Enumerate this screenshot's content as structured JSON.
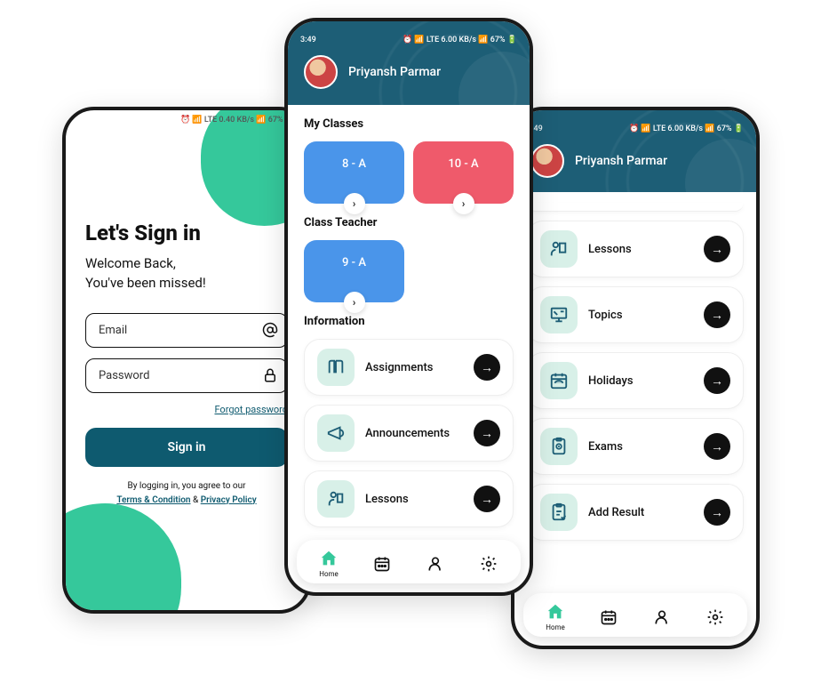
{
  "status": {
    "time": "3:49",
    "indicators": "⏰ 📶 LTE 6.00 KB/s 📶 67% 🔋"
  },
  "statusAlt": {
    "indicators": "⏰ 📶 LTE 0.40 KB/s 📶 67% 🔋"
  },
  "signin": {
    "title": "Let's Sign in",
    "welcome_line1": "Welcome Back,",
    "welcome_line2": "You've been missed!",
    "email_placeholder": "Email",
    "password_placeholder": "Password",
    "forgot": "Forgot password",
    "button": "Sign in",
    "agree_prefix": "By logging in, you agree to our",
    "terms": "Terms & Condition",
    "amp": " & ",
    "privacy": "Privacy Policy"
  },
  "dashboard": {
    "profile_name": "Priyansh Parmar",
    "my_classes_title": "My Classes",
    "classes": [
      {
        "label": "8 - A"
      },
      {
        "label": "10 - A"
      }
    ],
    "class_teacher_title": "Class Teacher",
    "class_teacher": {
      "label": "9 - A"
    },
    "information_title": "Information",
    "info_items": [
      {
        "label": "Assignments"
      },
      {
        "label": "Announcements"
      },
      {
        "label": "Lessons"
      }
    ]
  },
  "menu": {
    "profile_name": "Priyansh Parmar",
    "items": [
      {
        "label": "Lessons"
      },
      {
        "label": "Topics"
      },
      {
        "label": "Holidays"
      },
      {
        "label": "Exams"
      },
      {
        "label": "Add Result"
      }
    ]
  },
  "nav": {
    "home": "Home"
  }
}
